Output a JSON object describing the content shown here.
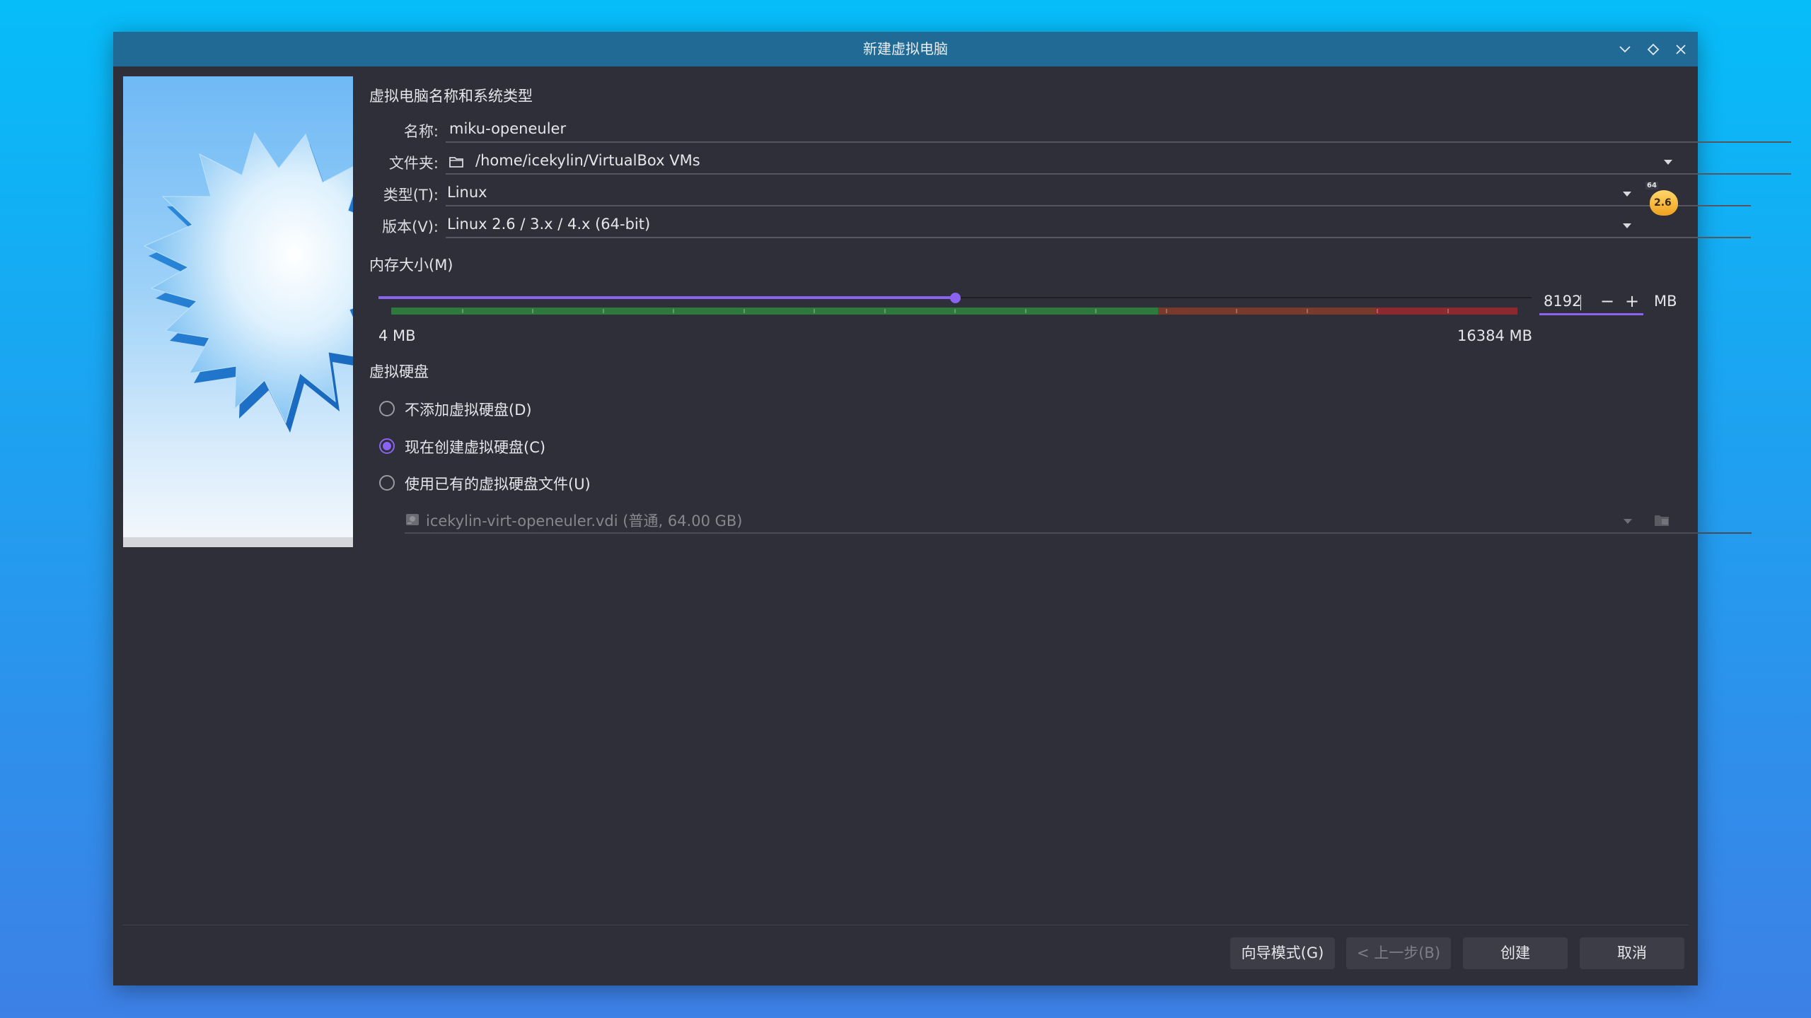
{
  "window": {
    "title": "新建虚拟电脑"
  },
  "name_section": {
    "title": "虚拟电脑名称和系统类型",
    "name_label": "名称:",
    "name_value": "miku-openeuler",
    "folder_label": "文件夹:",
    "folder_value": "/home/icekylin/VirtualBox VMs",
    "type_label": "类型(T):",
    "type_value": "Linux",
    "version_label": "版本(V):",
    "version_value": "Linux 2.6 / 3.x / 4.x (64-bit)",
    "os_badge": "2.6",
    "os_badge_bits": "64"
  },
  "memory": {
    "title": "内存大小(M)",
    "value": "8192",
    "unit": "MB",
    "min_label": "4 MB",
    "max_label": "16384 MB",
    "min": 4,
    "max": 16384,
    "current": 8192,
    "decrement": "−",
    "increment": "+",
    "slider_color": "#8a63f0",
    "safe_color": "#2d7a3a",
    "warn_color": "#7a3a2a",
    "danger_color": "#8c2a30"
  },
  "disk": {
    "title": "虚拟硬盘",
    "options": [
      {
        "label": "不添加虚拟硬盘(D)",
        "checked": false
      },
      {
        "label": "现在创建虚拟硬盘(C)",
        "checked": true
      },
      {
        "label": "使用已有的虚拟硬盘文件(U)",
        "checked": false
      }
    ],
    "existing_file": "icekylin-virt-openeuler.vdi (普通, 64.00 GB)"
  },
  "buttons": {
    "guided": "向导模式(G)",
    "back": "< 上一步(B)",
    "create": "创建",
    "cancel": "取消"
  }
}
